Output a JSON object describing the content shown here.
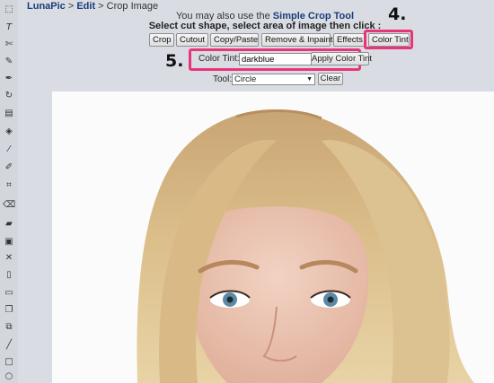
{
  "breadcrumb": {
    "root": "LunaPic",
    "sep1": " > ",
    "section": "Edit",
    "sep2": " > ",
    "current": "Crop Image"
  },
  "intro": {
    "text": "You may also use the ",
    "link": "Simple Crop Tool"
  },
  "instruction": "Select cut shape, select area of image then click :",
  "buttons": [
    "Crop",
    "Cutout",
    "Copy/Paste",
    "Remove & Inpaint",
    "Effects",
    "Color Tint"
  ],
  "callouts": {
    "four": "4.",
    "five": "5."
  },
  "tint": {
    "label": "Color Tint:",
    "value": "darkblue",
    "apply": "Apply Color Tint"
  },
  "tool_row": {
    "label": "Tool:",
    "selected": "Circle",
    "clear": "Clear"
  },
  "accent_color": "#e8357a",
  "link_color": "#1a3c7a",
  "toolbar_icons": [
    "select-icon",
    "text-icon",
    "scissors-icon",
    "pencil-icon",
    "pen-icon",
    "rotate-icon",
    "layers-icon",
    "fill-icon",
    "eyedropper-icon",
    "brush-icon",
    "crop-icon",
    "eraser-icon",
    "open-icon",
    "save-icon",
    "close-icon",
    "new-icon",
    "print-icon",
    "copy-icon",
    "paste-icon",
    "line-icon",
    "rectangle-icon",
    "ellipse-icon"
  ]
}
